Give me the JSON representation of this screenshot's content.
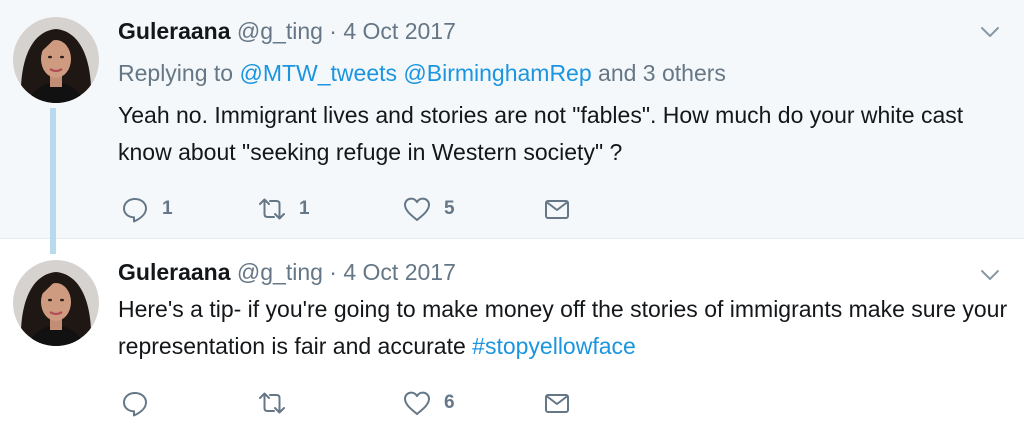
{
  "tweets": [
    {
      "name": "Guleraana",
      "handle": "@g_ting",
      "date": "· 4 Oct 2017",
      "reply_prefix": "Replying to",
      "reply_mention_1": "@MTW_tweets",
      "reply_mention_2": "@BirminghamRep",
      "reply_suffix": "and 3 others",
      "text": "Yeah no. Immigrant lives and stories are not \"fables\". How much do your white cast know about \"seeking refuge in Western society\" ?",
      "replies": "1",
      "retweets": "1",
      "likes": "5"
    },
    {
      "name": "Guleraana",
      "handle": "@g_ting",
      "date": "· 4 Oct 2017",
      "text": "Here's a tip- if you're going to make money off the stories of immigrants make sure your representation is fair and accurate",
      "hashtag": "#stopyellowface",
      "likes": "6"
    }
  ],
  "colors": {
    "link": "#1b95e0",
    "secondary_text": "#657786",
    "primary_text": "#14171a",
    "thread_line": "#b8d9ee",
    "highlight_bg": "#f5f8fa"
  },
  "icons": [
    "reply-icon",
    "retweet-icon",
    "like-icon",
    "direct-message-icon",
    "chevron-down-icon"
  ]
}
